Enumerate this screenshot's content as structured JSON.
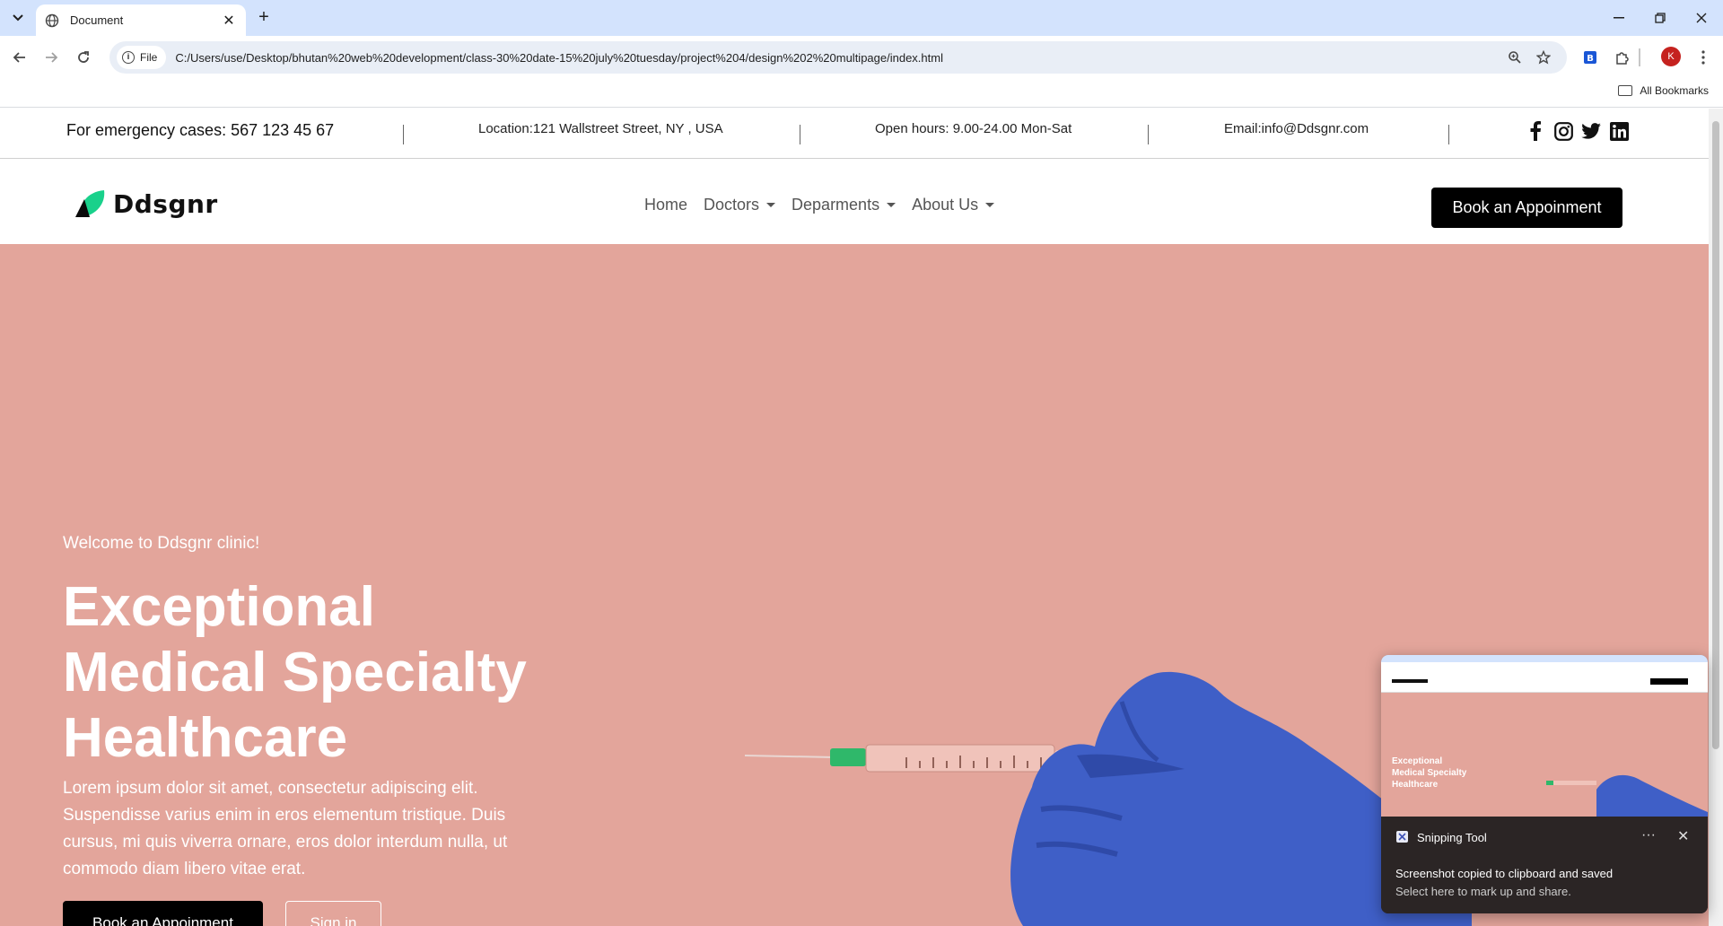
{
  "browser": {
    "tab_title": "Document",
    "url_scheme_label": "File",
    "url": "C:/Users/use/Desktop/bhutan%20web%20development/class-30%20date-15%20july%20tuesday/project%204/design%202%20multipage/index.html",
    "bookmarks_label": "All Bookmarks",
    "profile_initial": "K"
  },
  "topbar": {
    "emergency": "For emergency cases: 567 123 45 67",
    "location": "Location:121 Wallstreet Street, NY , USA",
    "hours": "Open hours: 9.00-24.00 Mon-Sat",
    "email": "Email:info@Ddsgnr.com",
    "social_icons": [
      "facebook-icon",
      "instagram-icon",
      "twitter-icon",
      "linkedin-icon"
    ]
  },
  "navbar": {
    "brand": "Ddsgnr",
    "links": [
      {
        "label": "Home",
        "dropdown": false
      },
      {
        "label": "Doctors",
        "dropdown": true
      },
      {
        "label": "Deparments",
        "dropdown": true
      },
      {
        "label": "About Us",
        "dropdown": true
      }
    ],
    "cta": "Book an Appoinment"
  },
  "hero": {
    "welcome": "Welcome to Ddsgnr clinic!",
    "title_lines": [
      "Exceptional",
      "Medical Specialty",
      "Healthcare"
    ],
    "text": "Lorem ipsum dolor sit amet, consectetur adipiscing elit. Suspendisse varius enim in eros elementum tristique. Duis cursus, mi quis viverra ornare, eros dolor interdum nulla, ut commodo diam libero vitae erat.",
    "primary_button": "Book an Appoinment",
    "secondary_button": "Sign in"
  },
  "snipping_tool": {
    "app_name": "Snipping Tool",
    "message": "Screenshot copied to clipboard and saved",
    "sub_message": "Select here to mark up and share.",
    "thumb_title_lines": [
      "Exceptional",
      "Medical Specialty",
      "Healthcare"
    ]
  },
  "colors": {
    "hero_bg": "#e3a59b",
    "brand_green": "#19d18b",
    "glove_blue": "#3f5fc7",
    "tabstrip": "#d3e3fd"
  }
}
